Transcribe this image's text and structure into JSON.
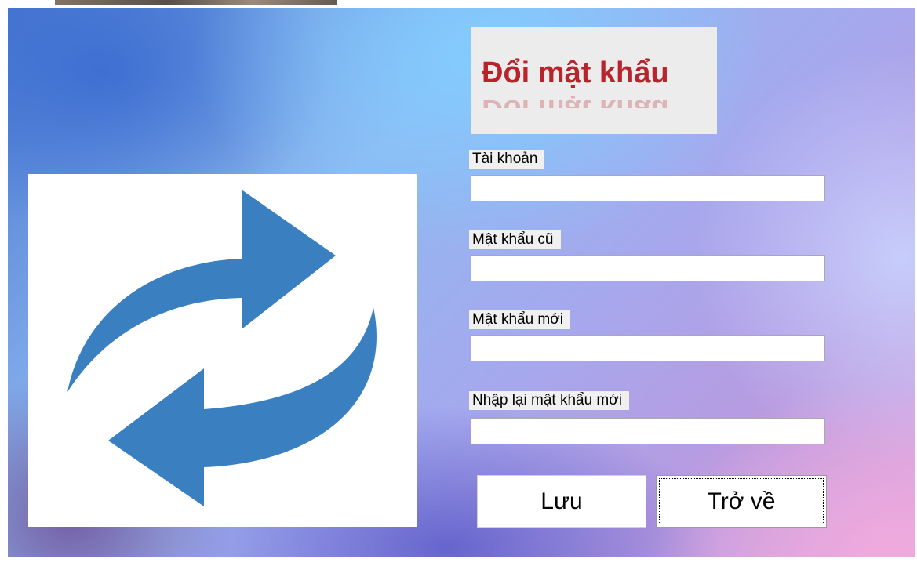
{
  "form": {
    "title": "Đổi mật khẩu",
    "accent_color": "#b8242c",
    "icon": "refresh-arrows-icon",
    "icon_color": "#3a7fc0"
  },
  "fields": [
    {
      "label": "Tài khoản",
      "value": "",
      "placeholder": ""
    },
    {
      "label": "Mật khẩu cũ",
      "value": "",
      "placeholder": ""
    },
    {
      "label": "Mật khẩu mới",
      "value": "",
      "placeholder": ""
    },
    {
      "label": "Nhập lại mật khẩu mới",
      "value": "",
      "placeholder": ""
    }
  ],
  "buttons": {
    "save_label": "Lưu",
    "back_label": "Trở về"
  }
}
